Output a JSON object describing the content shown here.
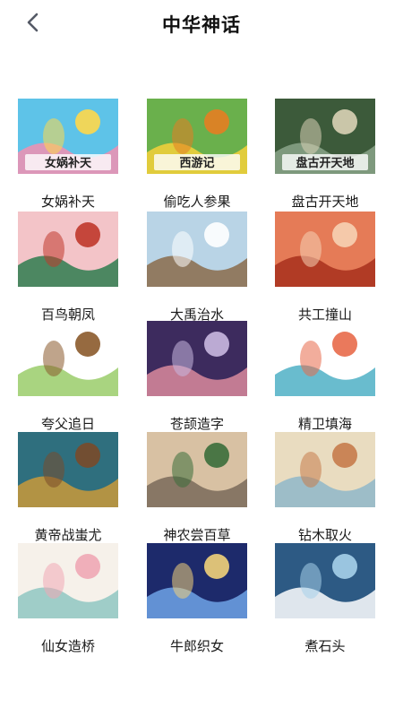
{
  "header": {
    "title": "中华神话",
    "back_icon": "chevron-left-icon"
  },
  "stories": [
    {
      "label": "女娲补天",
      "thumb_text": "女娲补天",
      "colors": [
        "#5ec3e8",
        "#f28fb0",
        "#ffd84a"
      ]
    },
    {
      "label": "偷吃人参果",
      "thumb_text": "西游记",
      "colors": [
        "#6ab04c",
        "#f6d13a",
        "#e67e22"
      ]
    },
    {
      "label": "盘古开天地",
      "thumb_text": "盘古开天地",
      "colors": [
        "#3c5a3a",
        "#8aa58a",
        "#d9d2b6"
      ]
    },
    {
      "label": "百鸟朝凤",
      "thumb_text": "",
      "colors": [
        "#f3c4c8",
        "#2e7d4f",
        "#c0392b"
      ]
    },
    {
      "label": "大禹治水",
      "thumb_text": "",
      "colors": [
        "#b9d4e6",
        "#8a6b4a",
        "#ffffff"
      ]
    },
    {
      "label": "共工撞山",
      "thumb_text": "",
      "colors": [
        "#e57b57",
        "#a8301c",
        "#f6d2b4"
      ]
    },
    {
      "label": "夸父追日",
      "thumb_text": "",
      "colors": [
        "#ffffff",
        "#9acd6a",
        "#8b5a2b"
      ]
    },
    {
      "label": "苍颉造字",
      "thumb_text": "",
      "colors": [
        "#3d2b5e",
        "#d98a9c",
        "#c9b8e0"
      ]
    },
    {
      "label": "精卫填海",
      "thumb_text": "",
      "colors": [
        "#ffffff",
        "#4fb0c6",
        "#e86a4a"
      ]
    },
    {
      "label": "黄帝战蚩尤",
      "thumb_text": "",
      "colors": [
        "#2f6f7e",
        "#c99a3a",
        "#7a4a2a"
      ]
    },
    {
      "label": "神农尝百草",
      "thumb_text": "",
      "colors": [
        "#d8c1a3",
        "#7a6a5a",
        "#3b6e3b"
      ]
    },
    {
      "label": "钻木取火",
      "thumb_text": "",
      "colors": [
        "#e9dcc0",
        "#8fb7c9",
        "#c67b4b"
      ]
    },
    {
      "label": "仙女造桥",
      "thumb_text": "",
      "colors": [
        "#f6f1ea",
        "#8fc7c2",
        "#f0a7b5"
      ]
    },
    {
      "label": "牛郎织女",
      "thumb_text": "",
      "colors": [
        "#1d2a6b",
        "#6fa3e6",
        "#f2d27a"
      ]
    },
    {
      "label": "煮石头",
      "thumb_text": "",
      "colors": [
        "#2d5a84",
        "#ffffff",
        "#a6d0ea"
      ]
    }
  ]
}
